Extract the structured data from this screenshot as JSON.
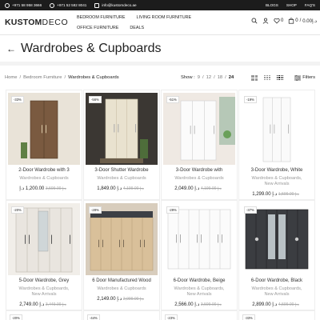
{
  "topbar": {
    "phone1": "+971 58 958 3666",
    "phone2": "+971 52 582 8041",
    "email": "info@kustomdeco.ae",
    "links": [
      "BLOGS",
      "SHOP",
      "FAQ'S"
    ]
  },
  "header": {
    "logo_bold": "KUSTOM",
    "logo_thin": "DECO",
    "nav": [
      "BEDROOM FURNITURE",
      "LIVING ROOM FURNITURE",
      "OFFICE FURNITURE",
      "DEALS"
    ],
    "wishlist_count": "0",
    "cart_count": "0",
    "cart_total": "د.إ0.00"
  },
  "title": "Wardrobes & Cupboards",
  "breadcrumb": {
    "home": "Home",
    "sep": "/",
    "parent": "Bedroom Furniture",
    "current": "Wardrobes & Cupboards"
  },
  "toolbar": {
    "show_label": "Show :",
    "show_options": [
      "9",
      "12",
      "18"
    ],
    "show_selected": "24",
    "filters_label": "Filters"
  },
  "products": [
    {
      "badge": "-33%",
      "name": "2-Door Wardrobe with 3",
      "cat": [
        "Wardrobes & Cupboards"
      ],
      "old": "د.إ 3,599.00",
      "new": "1,200.00 د.إ",
      "style": "wood2"
    },
    {
      "badge": "-56%",
      "name": "3-Door Shutter Wardrobe",
      "cat": [
        "Wardrobes & Cupboards"
      ],
      "old": "د.إ 4,199.00",
      "new": "د.إ 1,849.00",
      "style": "shutter"
    },
    {
      "badge": "-51%",
      "name": "3-Door Wardrobe with",
      "cat": [
        "Wardrobes & Cupboards"
      ],
      "old": "د.إ 4,199.00",
      "new": "د.إ 2,049.00",
      "style": "white3"
    },
    {
      "badge": "-19%",
      "name": "3-Door Wardrobe, White",
      "cat": [
        "Wardrobes & Cupboards,",
        "New Arrivals"
      ],
      "old": "د.إ 1,599.00",
      "new": "د.إ 1,299.00",
      "style": "white3plain"
    },
    {
      "badge": "-20%",
      "name": "5-Door Wardrobe, Grey",
      "cat": [
        "Wardrobes & Cupboards,",
        "New Arrivals"
      ],
      "old": "د.إ 3,449.00",
      "new": "د.إ 2,749.00",
      "style": "grey5"
    },
    {
      "badge": "-28%",
      "name": "6 Door Manufactured Wood",
      "cat": [
        "Wardrobes & Cupboards"
      ],
      "old": "د.إ 2,999.00",
      "new": "د.إ 2,149.00",
      "style": "beige6"
    },
    {
      "badge": "-29%",
      "name": "6-Door Wardrobe, Beige",
      "cat": [
        "Wardrobes & Cupboards,",
        "New Arrivals"
      ],
      "old": "د.إ 3,599.00",
      "new": "د.إ 2,566.00",
      "style": "white6"
    },
    {
      "badge": "-37%",
      "name": "6-Door Wardrobe, Black",
      "cat": [
        "Wardrobes & Cupboards,",
        "New Arrivals"
      ],
      "old": "د.إ 4,599.00",
      "new": "د.إ 2,899.00",
      "style": "black6"
    }
  ],
  "row3_badges": [
    "-20%",
    "-44%",
    "-23%",
    "-33%"
  ]
}
